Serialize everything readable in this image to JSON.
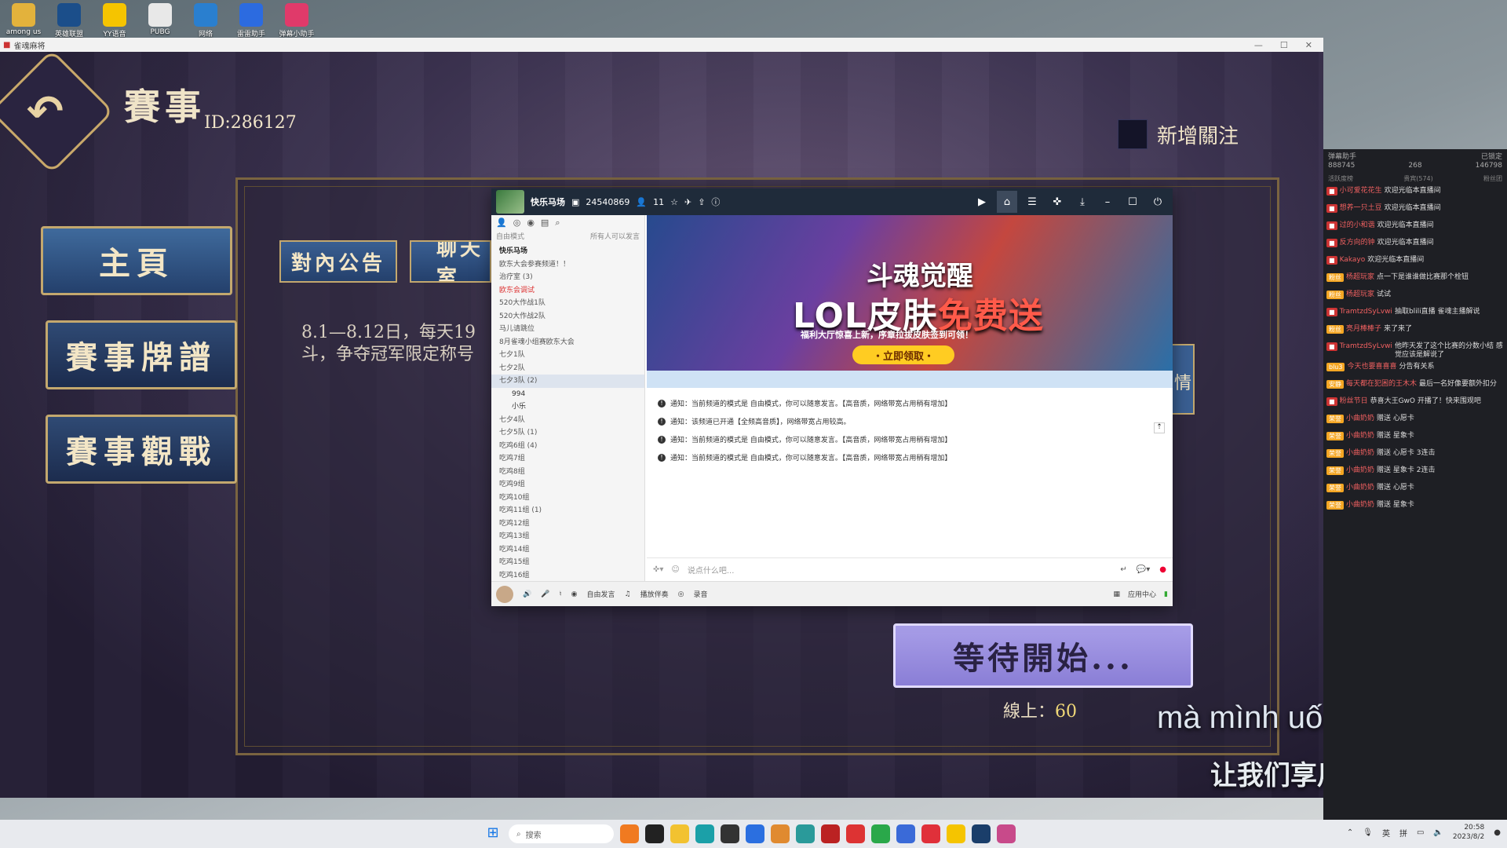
{
  "desktop": {
    "icons": [
      {
        "label": "among us",
        "color": "#e3b23c"
      },
      {
        "label": "英雄联盟",
        "color": "#1b4e8a"
      },
      {
        "label": "YY语音",
        "color": "#f5c400"
      },
      {
        "label": "PUBG",
        "color": "#e8e8e8"
      },
      {
        "label": "网络",
        "color": "#2a7fcf"
      },
      {
        "label": "雷雷助手",
        "color": "#2c6be0"
      },
      {
        "label": "弹幕小助手",
        "color": "#e03a6a"
      }
    ]
  },
  "game_window": {
    "title": "雀魂麻将",
    "title_main": "賽事",
    "event_id": "ID:286127",
    "follow_label": "新增關注",
    "nav": [
      "主頁",
      "賽事牌譜",
      "賽事觀戰"
    ],
    "tabs": [
      "對內公告",
      "聊天室"
    ],
    "notice_line1": "8.1—8.12日，每天19",
    "notice_line2": "斗，争夺冠军限定称号",
    "wait_label": "等待開始...",
    "online_label": "線上：",
    "online_count": "60",
    "side_fragment": "情"
  },
  "subtitles": {
    "line1": "mà mình uống đi",
    "line2": "让我们享用吧"
  },
  "yy_window": {
    "channel_name": "快乐马场",
    "channel_id": "24540869",
    "online_count": "11",
    "mode_label": "自由模式",
    "mode_hint": "所有人可以发言",
    "channel_list": [
      {
        "text": "快乐马场",
        "style": "bold"
      },
      {
        "text": "欧东大会参赛频道！！",
        "style": ""
      },
      {
        "text": "治疗室 (3)",
        "style": ""
      },
      {
        "text": "欧东会调试",
        "style": "red"
      },
      {
        "text": "520大作战1队",
        "style": ""
      },
      {
        "text": "520大作战2队",
        "style": ""
      },
      {
        "text": "马儿请跳位",
        "style": ""
      },
      {
        "text": "8月雀魂小组赛欧东大会",
        "style": ""
      },
      {
        "text": "七夕1队",
        "style": ""
      },
      {
        "text": "七夕2队",
        "style": ""
      },
      {
        "text": "七夕3队 (2)",
        "style": "hl"
      },
      {
        "text": "994",
        "style": "sub"
      },
      {
        "text": "小乐",
        "style": "sub"
      },
      {
        "text": "七夕4队",
        "style": ""
      },
      {
        "text": "七夕5队 (1)",
        "style": ""
      },
      {
        "text": "吃鸡6组 (4)",
        "style": ""
      },
      {
        "text": "吃鸡7组",
        "style": ""
      },
      {
        "text": "吃鸡8组",
        "style": ""
      },
      {
        "text": "吃鸡9组",
        "style": ""
      },
      {
        "text": "吃鸡10组",
        "style": ""
      },
      {
        "text": "吃鸡11组 (1)",
        "style": ""
      },
      {
        "text": "吃鸡12组",
        "style": ""
      },
      {
        "text": "吃鸡13组",
        "style": ""
      },
      {
        "text": "吃鸡14组",
        "style": ""
      },
      {
        "text": "吃鸡15组",
        "style": ""
      },
      {
        "text": "吃鸡16组",
        "style": ""
      }
    ],
    "banner": {
      "logo": "斗魂觉醒",
      "headline_a": "LOL皮肤",
      "headline_b": "免费送",
      "subline": "福利大厅惊喜上新，序章拉拔皮肤签到可领！",
      "button": "・立即领取・"
    },
    "messages": [
      "通知：当前频道的模式是 自由模式，你可以随意发言。【高音质，网络带宽占用稍有增加】",
      "通知：该频道已开通【全频高音质】，网络带宽占用较高。",
      "通知：当前频道的模式是 自由模式，你可以随意发言。【高音质，网络带宽占用稍有增加】",
      "通知：当前频道的模式是 自由模式，你可以随意发言。【高音质，网络带宽占用稍有增加】"
    ],
    "input_placeholder": "说点什么吧...",
    "bottom": {
      "free_speak": "自由发言",
      "play_music": "播放伴奏",
      "record": "录音",
      "app_center": "应用中心"
    }
  },
  "chat_panel": {
    "title": "弹幕助手",
    "status": "已锁定",
    "stat1": "888745",
    "stat2": "268",
    "stat3": "146798",
    "tab1": "活跃度榜",
    "tab2": "贵宾(574)",
    "tab3": "粉丝团",
    "lines": [
      {
        "badge": "",
        "user": "小可爱花花生",
        "text": "欢迎光临本直播间"
      },
      {
        "badge": "",
        "user": "想养一只土豆",
        "text": "欢迎光临本直播间"
      },
      {
        "badge": "",
        "user": "过的小和谐",
        "text": "欢迎光临本直播间"
      },
      {
        "badge": "",
        "user": "反方向的钟",
        "text": "欢迎光临本直播间"
      },
      {
        "badge": "",
        "user": "Kakayo",
        "text": "欢迎光临本直播间"
      },
      {
        "badge": "粉丝",
        "user": "杨超玩家",
        "text": "点一下是谁谁做比赛那个栓钮"
      },
      {
        "badge": "粉丝",
        "user": "杨超玩家",
        "text": "试试"
      },
      {
        "badge": "",
        "user": "TramtzdSyLvwi",
        "text": "抽取blili直播 雀魂主播解说"
      },
      {
        "badge": "粉丝",
        "user": "亮月棒棒子",
        "text": "来了来了"
      },
      {
        "badge": "",
        "user": "TramtzdSyLvwi",
        "text": "他昨天发了这个比赛的分数小结 感觉应该是解说了"
      },
      {
        "badge": "blu3",
        "user": "今天也要喜喜喜",
        "text": "分告有关系"
      },
      {
        "badge": "安静",
        "user": "每天都在犯困的王木木",
        "text": "最后一名好像要额外扣分"
      },
      {
        "badge": "",
        "user": "粉丝节日",
        "text": "恭喜大王GwO 开播了！快来围观吧"
      },
      {
        "badge": "荣誉",
        "user": "小曲奶奶",
        "text": "赠送 心愿卡"
      },
      {
        "badge": "荣誉",
        "user": "小曲奶奶",
        "text": "赠送 星象卡"
      },
      {
        "badge": "荣誉",
        "user": "小曲奶奶",
        "text": "赠送 心愿卡 3连击"
      },
      {
        "badge": "荣誉",
        "user": "小曲奶奶",
        "text": "赠送 星象卡 2连击"
      },
      {
        "badge": "荣誉",
        "user": "小曲奶奶",
        "text": "赠送 心愿卡"
      },
      {
        "badge": "荣誉",
        "user": "小曲奶奶",
        "text": "赠送 星象卡"
      }
    ]
  },
  "taskbar": {
    "search_placeholder": "搜索",
    "ime": "英",
    "ime2": "拼",
    "time": "20:58",
    "date": "2023/8/2"
  },
  "colors": {
    "accent_gold": "#c9a96a",
    "yy_dark": "#1f2b3a",
    "wait_button": "#9b91e2"
  }
}
